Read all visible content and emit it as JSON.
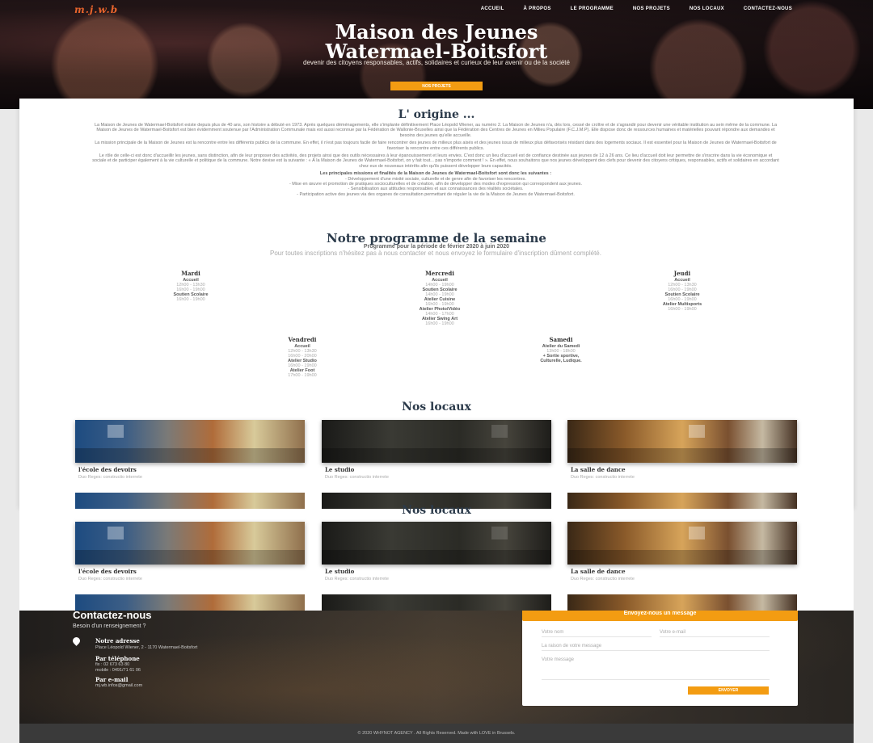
{
  "header": {
    "logo": "m.j.w.b",
    "nav": [
      "ACCUEIL",
      "À PROPOS",
      "LE PROGRAMME",
      "NOS PROJETS",
      "NOS LOCAUX",
      "CONTACTEZ-NOUS"
    ]
  },
  "hero": {
    "title_line1": "Maison des Jeunes",
    "title_line2": "Watermael-Boitsfort",
    "subtitle": "devenir des citoyens responsables, actifs, solidaires et curieux de leur avenir ou de la société",
    "button": "NOS PROJETS"
  },
  "origin": {
    "title": "L' origine ...",
    "p1": "La Maison de Jeunes de Watermael-Boitsfort existe depuis plus de 40 ans, son histoire a débuté en 1973. Après quelques déménagements, elle s'implante définitivement Place Léopold Wiener, au numéro 2. La Maison de Jeunes n'a, dès lors, cessé de croître et de s'agrandir pour devenir une véritable institution au sein même de la commune. La Maison de Jeunes de Watermael-Boitsfort est bien évidemment soutenue par l'Administration Communale mais est aussi reconnue par la Fédération de Wallonie-Bruxelles ainsi que la Fédération des Centres de Jeunes en Milieu Populaire (F.C.J.M.P). Elle dispose donc de ressources humaines et matérielles pouvant répondre aux demandes et besoins des jeunes qu'elle accueille.",
    "p2": "La mission principale de la Maison de Jeunes est la rencontre entre les différents publics de la commune. En effet, il n'est pas toujours facile de faire rencontrer des jeunes de milieux plus aisés et des jeunes issus de milieux plus défavorisés résidant dans des logements sociaux. Il est essentiel pour la Maison de Jeunes de Watermael-Boitsfort de favoriser la rencontre entre ces différents publics.",
    "p3": "Le rôle de celle-ci est donc d'accueillir les jeunes, sans distinction, afin de leur proposer des activités, des projets ainsi que des outils nécessaires à leur épanouissement et leurs envies. C'est donc un lieu d'accueil est de confiance destinée aux jeunes de 12 à 26 ans. Ce lieu d'accueil doit leur permettre de s'inscrire dans la vie économique et sociale et de participer également à la vie culturelle et politique de la commune. Notre devise est la suivante : « À la Maison de Jeunes de Watermael-Boitsfort, on y fait tout... pas n'importe comment ! ». En effet, nous souhaitons que nos jeunes développent des clefs pour devenir des citoyens critiques, responsables, actifs et solidaires en accordant chez eux de nouveaux intérêts afin qu'ils puissent développer leurs capacités.",
    "missions_title": "Les principales missions et finalités de la Maison de Jeunes de Watermael-Boitsfort sont donc les suivantes :",
    "missions": [
      "- Développement d'une mixité sociale, culturelle et de genre afin de favoriser les rencontres.",
      "- Mise en œuvre et promotion de pratiques socioculturelles et de création, afin de développer des modes d'expression qui correspondent aux jeunes.",
      "- Sensibilisation aux attitudes responsables et aux connaissances des réalités sociétales.",
      "- Participation active des jeunes via des organes de consultation permettant de réguler la vie de la Maison de Jeunes de Watermael-Boitsfort."
    ]
  },
  "programme": {
    "title": "Notre programme de la semaine",
    "period": "Programme pour la période de février 2020 à juin 2020",
    "note": "Pour toutes inscriptions n'hésitez pas à nous contacter et nous envoyez le formulaire d'inscription dûment complété.",
    "days": [
      {
        "name": "Mardi",
        "lines": [
          [
            "Accueil",
            true
          ],
          [
            "12h00 - 13h30",
            false
          ],
          [
            "16h00 - 19h00",
            false
          ],
          [
            "Soutien Scolaire",
            true
          ],
          [
            "16h00 - 19h00",
            false
          ]
        ]
      },
      {
        "name": "Mercredi",
        "lines": [
          [
            "Accueil",
            true
          ],
          [
            "14h00 - 19h00",
            false
          ],
          [
            "Soutien Scolaire",
            true
          ],
          [
            "14h00 - 19h00",
            false
          ],
          [
            "Atelier Cuisine",
            true
          ],
          [
            "16h00 - 19h00",
            false
          ],
          [
            "Atelier Photo/Vidéo",
            true
          ],
          [
            "14h00 - 17h00",
            false
          ],
          [
            "Atelier Swing Art",
            true
          ],
          [
            "16h00 - 19h00",
            false
          ]
        ]
      },
      {
        "name": "Jeudi",
        "lines": [
          [
            "Accueil",
            true
          ],
          [
            "12h00 - 13h30",
            false
          ],
          [
            "16h00 - 19h00",
            false
          ],
          [
            "Soutien Scolaire",
            true
          ],
          [
            "16h00 - 19h00",
            false
          ],
          [
            "Atelier Multisports",
            true
          ],
          [
            "16h00 - 19h00",
            false
          ]
        ]
      },
      {
        "name": "Vendredi",
        "lines": [
          [
            "Accueil",
            true
          ],
          [
            "12h00 - 13h30",
            false
          ],
          [
            "16h00 - 20h00",
            false
          ],
          [
            "Atelier Studio",
            true
          ],
          [
            "16h00 - 19h00",
            false
          ],
          [
            "Atelier Foot",
            true
          ],
          [
            "17h00 - 19h00",
            false
          ]
        ]
      },
      {
        "name": "Samedi",
        "lines": [
          [
            "Atelier du Samedi",
            true
          ],
          [
            "13h00 - 18h00",
            false
          ],
          [
            "+ Sortie sportive,",
            true
          ],
          [
            "Culturelle, Ludique.",
            true
          ]
        ]
      }
    ]
  },
  "locaux": {
    "title": "Nos locaux",
    "rooms": [
      {
        "name": "l'école des devoirs",
        "desc": "Duo Reges: constructio interrete"
      },
      {
        "name": "Le studio",
        "desc": "Duo Reges: constructio interrete"
      },
      {
        "name": "La salle de dance",
        "desc": "Duo Reges: constructio interrete"
      }
    ]
  },
  "contact": {
    "title": "Contactez-nous",
    "subtitle": "Besoin d'un renseignement ?",
    "address_h": "Notre adresse",
    "address": "Place Léopold Wiener, 2 - 1170 Watermael-Boitsfort",
    "phone_h": "Par téléphone",
    "phone1": "fix : 02 673 63 80",
    "phone2": "mobile : 0491/71 61 06",
    "email_h": "Par e-mail",
    "email": "mj.wb.infos@gmail.com"
  },
  "form": {
    "title": "Envoyez-nous un message",
    "name_ph": "Votre nom",
    "email_ph": "Votre e-mail",
    "reason_ph": "La raison de votre message",
    "message_ph": "Votre message",
    "send": "ENVOYER"
  },
  "footer": {
    "text": "© 2020 WHYNOT AGENCY . All Rights Reserved. Made with LOVE in Brussels."
  },
  "colors": {
    "accent": "#f39c12",
    "title": "#2b3a4a"
  }
}
